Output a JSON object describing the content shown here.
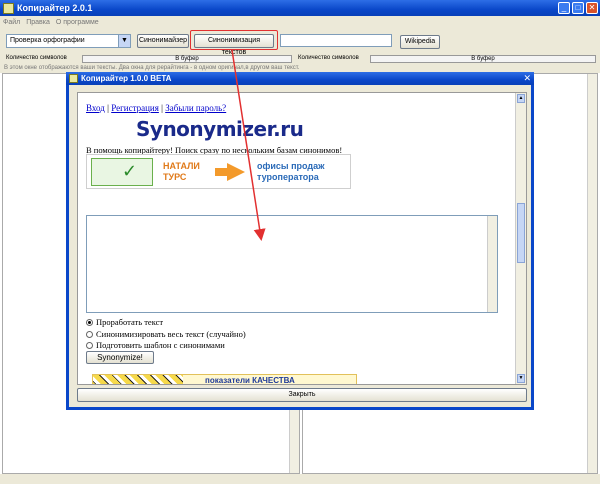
{
  "window": {
    "title": "Копирайтер 2.0.1",
    "controls": {
      "minimize": "_",
      "maximize": "□",
      "close": "✕"
    }
  },
  "menu": {
    "items": [
      "Файл",
      "Правка",
      "О программе"
    ]
  },
  "toolbar": {
    "mode_select_value": "Проверка орфографии",
    "synonymizer_button": "Синонимайзер",
    "synonymize_text_button": "Синонимизация текстов",
    "url_input_value": "",
    "wikipedia_button": "Wikipedia"
  },
  "status": {
    "left_count_label": "Количество символов",
    "left_buffer": "В буфер",
    "right_count_label": "Количество символов",
    "right_buffer": "В буфер",
    "hint": "В этом окне отображаются ваши тексты. Два окна для рерайтинга - в одном оригинал,в другом ваш текст."
  },
  "dialog": {
    "title": "Копирайтер 1.0.0 BETA",
    "close_glyph": "✕",
    "links": [
      "Вход",
      "Регистрация",
      "Забыли пароль?"
    ],
    "link_separator": " | ",
    "logo": "Synonymizer.ru",
    "tagline": "В помощь копирайтеру! Поиск сразу по нескольким базам синонимов!",
    "banner": {
      "left_text_1": "НАТАЛИ",
      "left_text_2": "ТУРС",
      "right_text_1": "офисы продаж",
      "right_text_2": "туроператора"
    },
    "text_value": "",
    "options": [
      {
        "label": "Проработать текст",
        "selected": true
      },
      {
        "label": "Синонимизировать весь текст (случайно)",
        "selected": false
      },
      {
        "label": "Подготовить шаблон с синонимами",
        "selected": false
      }
    ],
    "synonymize_button": "Synonymize!",
    "banner2_text": "показатели КАЧЕСТВА",
    "close_button": "Закрыть"
  },
  "colors": {
    "titlebar": "#0a47c9",
    "window_bg": "#ece9d8",
    "highlight": "#e23030",
    "link": "#0000cc",
    "logo": "#1a2a8a"
  }
}
